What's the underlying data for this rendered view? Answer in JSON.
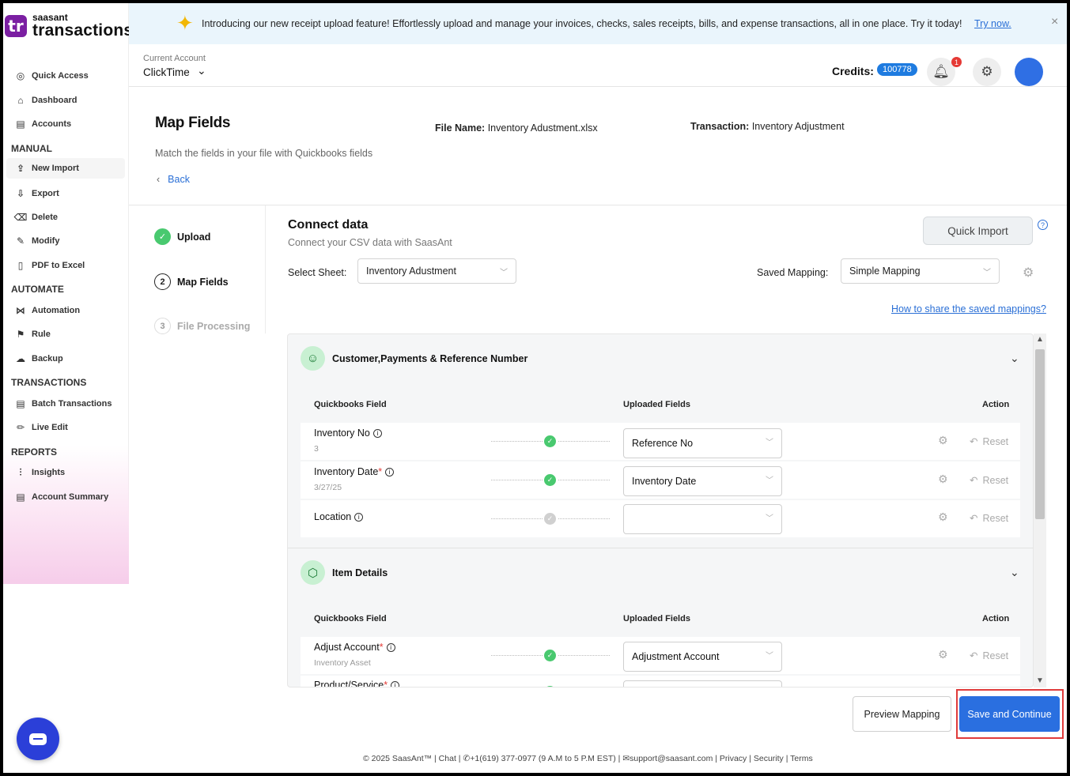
{
  "brand": {
    "top": "saasant",
    "product": "transactions",
    "mark": "tr"
  },
  "sidebar": {
    "top_items": [
      {
        "label": "Quick Access",
        "icon": "compass-icon",
        "glyph": "◎"
      },
      {
        "label": "Dashboard",
        "icon": "home-icon",
        "glyph": "⌂"
      },
      {
        "label": "Accounts",
        "icon": "clipboard-icon",
        "glyph": "▤"
      }
    ],
    "manual_label": "MANUAL",
    "manual_items": [
      {
        "label": "New Import",
        "icon": "cloud-upload-icon",
        "glyph": "⇪"
      },
      {
        "label": "Export",
        "icon": "cloud-download-icon",
        "glyph": "⇩"
      },
      {
        "label": "Delete",
        "icon": "trash-icon",
        "glyph": "🗑"
      },
      {
        "label": "Modify",
        "icon": "edit-file-icon",
        "glyph": "✎"
      },
      {
        "label": "PDF to Excel",
        "icon": "pdf-icon",
        "glyph": "▯"
      }
    ],
    "automate_label": "AUTOMATE",
    "automate_items": [
      {
        "label": "Automation",
        "icon": "share-nodes-icon",
        "glyph": "⋈"
      },
      {
        "label": "Rule",
        "icon": "signpost-icon",
        "glyph": "⚑"
      },
      {
        "label": "Backup",
        "icon": "cloud-backup-icon",
        "glyph": "☁"
      }
    ],
    "transactions_label": "TRANSACTIONS",
    "transactions_items": [
      {
        "label": "Batch Transactions",
        "icon": "document-icon",
        "glyph": "▤"
      },
      {
        "label": "Live Edit",
        "icon": "pencil-line-icon",
        "glyph": "✏"
      }
    ],
    "reports_label": "REPORTS",
    "reports_items": [
      {
        "label": "Insights",
        "icon": "sliders-icon",
        "glyph": "⫶"
      },
      {
        "label": "Account Summary",
        "icon": "clipboard-list-icon",
        "glyph": "▤"
      }
    ]
  },
  "banner": {
    "message": "Introducing our new receipt upload feature! Effortlessly upload and manage your invoices, checks, sales receipts, bills, and expense transactions, all in one place. Try it today!",
    "link": "Try now.",
    "close": "×"
  },
  "header": {
    "account_label": "Current Account",
    "account_value": "ClickTime",
    "credits_label": "Credits:",
    "credits_value": "100778",
    "notification_count": "1"
  },
  "page": {
    "title": "Map Fields",
    "subtitle": "Match the fields in your file with Quickbooks fields",
    "back": "Back",
    "file_name_label": "File Name:",
    "file_name_value": "Inventory Adustment.xlsx",
    "transaction_label": "Transaction:",
    "transaction_value": "Inventory Adjustment"
  },
  "steps": [
    {
      "num": "✓",
      "label": "Upload",
      "state": "done"
    },
    {
      "num": "2",
      "label": "Map Fields",
      "state": "current"
    },
    {
      "num": "3",
      "label": "File Processing",
      "state": "pending"
    }
  ],
  "connect": {
    "title": "Connect data",
    "subtitle": "Connect your CSV data with SaasAnt",
    "quick_import": "Quick Import",
    "select_sheet_label": "Select Sheet:",
    "select_sheet_value": "Inventory Adustment",
    "saved_mapping_label": "Saved Mapping:",
    "saved_mapping_value": "Simple Mapping",
    "share_link": "How to share the saved mappings?"
  },
  "mapping": {
    "col_qb": "Quickbooks Field",
    "col_uploaded": "Uploaded Fields",
    "col_action": "Action",
    "reset_label": "Reset",
    "sections": [
      {
        "title": "Customer,Payments & Reference Number",
        "rows": [
          {
            "field": "Inventory No",
            "required": "",
            "sample": "3",
            "mapped": "Reference No",
            "status": "ok"
          },
          {
            "field": "Inventory Date",
            "required": "*",
            "sample": "3/27/25",
            "mapped": "Inventory Date",
            "status": "ok"
          },
          {
            "field": "Location",
            "required": "",
            "sample": "",
            "mapped": "",
            "status": "none"
          }
        ]
      },
      {
        "title": "Item Details",
        "rows": [
          {
            "field": "Adjust Account",
            "required": "*",
            "sample": "Inventory Asset",
            "mapped": "Adjustment Account",
            "status": "ok"
          },
          {
            "field": "Product/Service",
            "required": "*",
            "sample": "",
            "mapped": "",
            "status": "ok"
          }
        ]
      }
    ]
  },
  "actions": {
    "preview": "Preview Mapping",
    "save": "Save and Continue"
  },
  "footer": "© 2025 SaasAnt™  | Chat  |  ✆+1(619) 377-0977 (9 A.M to 5 P.M EST)  |  ✉support@saasant.com  | Privacy  | Security  | Terms"
}
